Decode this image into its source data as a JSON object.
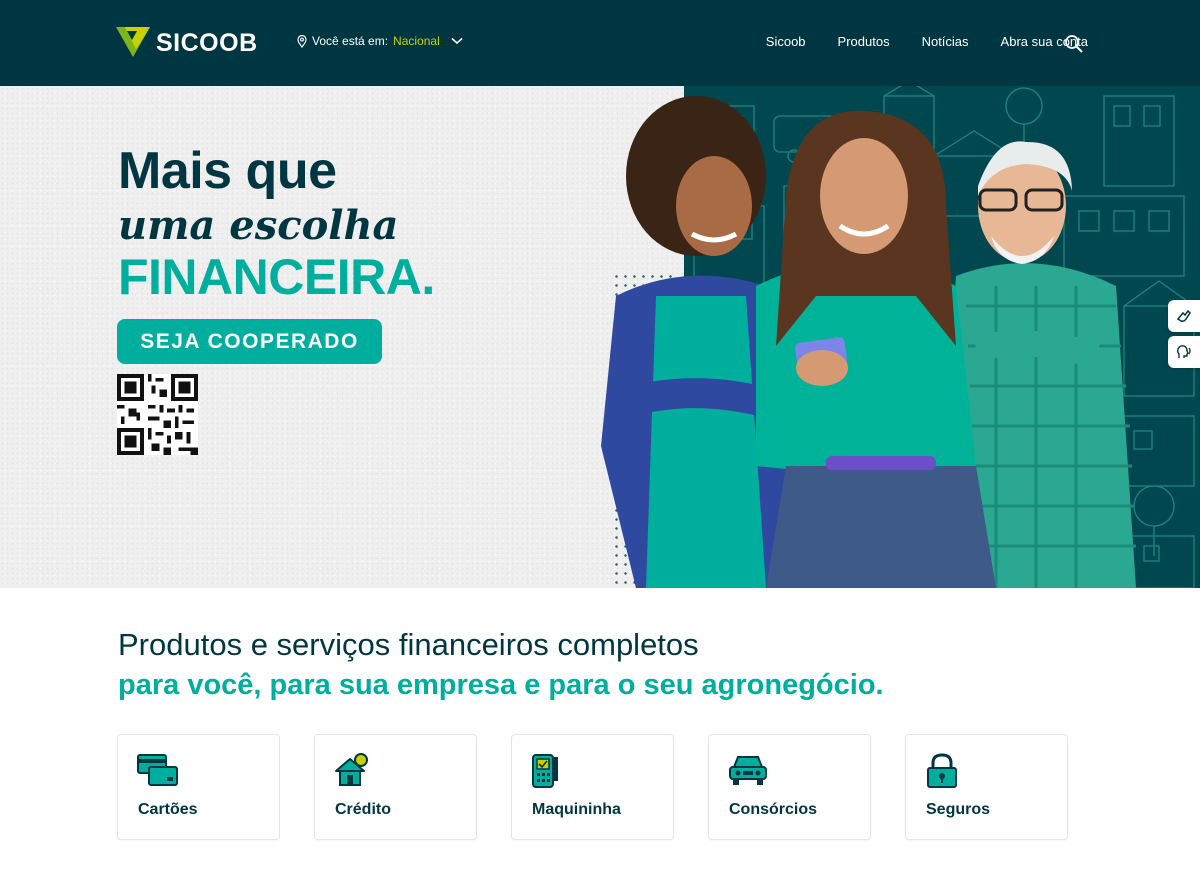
{
  "header": {
    "brand": "SICOOB",
    "location_prefix": "Você está em:",
    "location_value": "Nacional",
    "nav": [
      "Sicoob",
      "Produtos",
      "Notícias",
      "Abra sua conta"
    ]
  },
  "hero": {
    "line1": "Mais que",
    "line2": "uma escolha",
    "line3": "FINANCEIRA.",
    "cta": "SEJA COOPERADO"
  },
  "products": {
    "title": "Produtos e serviços financeiros completos",
    "subtitle": "para você, para sua empresa e para o seu agronegócio.",
    "cards": [
      {
        "label": "Cartões",
        "icon": "cards-icon"
      },
      {
        "label": "Crédito",
        "icon": "house-coin-icon"
      },
      {
        "label": "Maquininha",
        "icon": "card-machine-icon"
      },
      {
        "label": "Consórcios",
        "icon": "car-icon"
      },
      {
        "label": "Seguros",
        "icon": "padlock-icon"
      }
    ]
  },
  "colors": {
    "dark_teal": "#003641",
    "turquoise": "#00ae9d",
    "lime": "#c9d200",
    "green": "#7db61c"
  }
}
